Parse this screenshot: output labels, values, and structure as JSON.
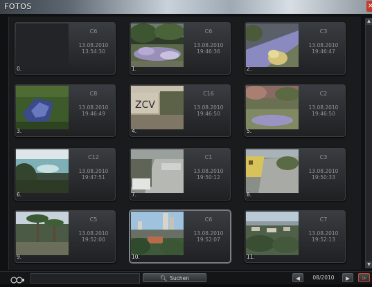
{
  "window": {
    "title": "FOTOS",
    "close_symbol": "×"
  },
  "tiles": [
    {
      "index": "0.",
      "camera": "C6",
      "date": "13.08.2010",
      "time": "13:54:30",
      "thumb": "dark-icon"
    },
    {
      "index": "1.",
      "camera": "C6",
      "date": "13.08.2010",
      "time": "19:46:36",
      "thumb": "flower-garden-icon"
    },
    {
      "index": "2.",
      "camera": "C3",
      "date": "13.08.2010",
      "time": "19:46:47",
      "thumb": "garden-path-icon"
    },
    {
      "index": "3.",
      "camera": "C8",
      "date": "13.08.2010",
      "time": "19:46:49",
      "thumb": "pool-pump-icon"
    },
    {
      "index": "4.",
      "camera": "C16",
      "date": "13.08.2010",
      "time": "19:46:50",
      "thumb": "wall-graffiti-icon"
    },
    {
      "index": "5.",
      "camera": "C2",
      "date": "13.08.2010",
      "time": "19:46:50",
      "thumb": "lawn-icon"
    },
    {
      "index": "6.",
      "camera": "C12",
      "date": "13.08.2010",
      "time": "19:47:51",
      "thumb": "bay-view-icon"
    },
    {
      "index": "7.",
      "camera": "C1",
      "date": "13.08.2010",
      "time": "19:50:12",
      "thumb": "street-icon"
    },
    {
      "index": "8.",
      "camera": "C3",
      "date": "13.08.2010",
      "time": "19:50:33",
      "thumb": "yellow-house-icon"
    },
    {
      "index": "9.",
      "camera": "C5",
      "date": "13.08.2010",
      "time": "19:52:00",
      "thumb": "palm-trees-icon"
    },
    {
      "index": "10.",
      "camera": "C6",
      "date": "13.08.2010",
      "time": "19:52:07",
      "thumb": "city-skyline-icon"
    },
    {
      "index": "11.",
      "camera": "C7",
      "date": "13.08.2010",
      "time": "19:52:13",
      "thumb": "town-aerial-icon"
    }
  ],
  "selected_index": 10,
  "footer": {
    "search_label": "Suchen",
    "search_icon": "magnifier-icon",
    "month": "08/2010",
    "prev_symbol": "◀",
    "next_symbol": "▶",
    "reload_symbol": "⟳"
  },
  "colors": {
    "accent": "#c44a33",
    "label": "#8e9398"
  }
}
